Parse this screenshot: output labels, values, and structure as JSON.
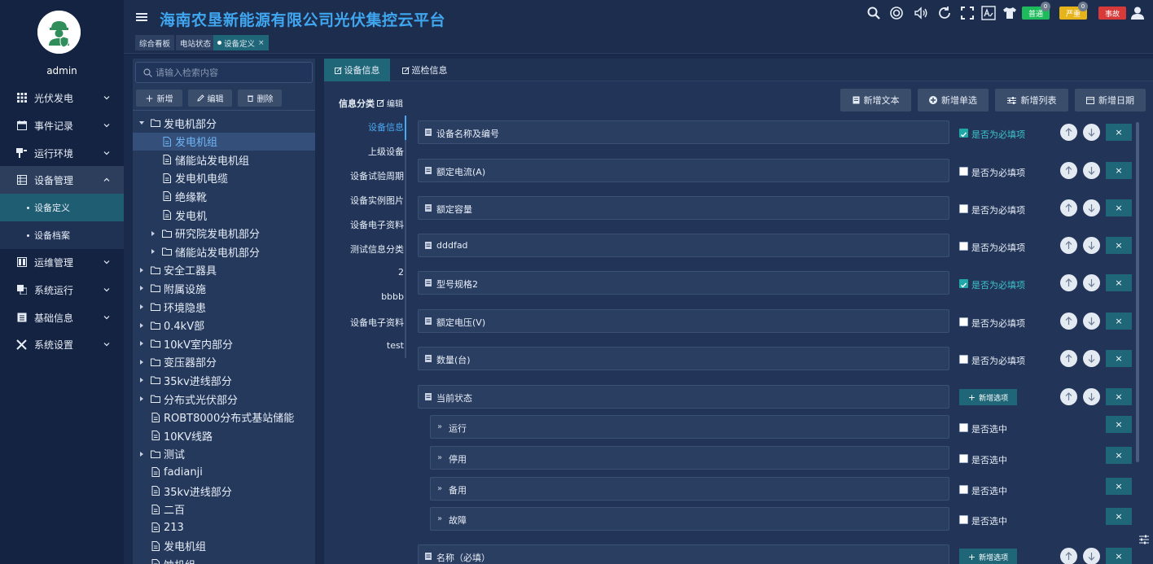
{
  "app": {
    "title": "海南农垦新能源有限公司光伏集控云平台"
  },
  "user": {
    "name": "admin"
  },
  "sidebar": {
    "items": [
      {
        "label": "光伏发电",
        "icon": "grid-icon"
      },
      {
        "label": "事件记录",
        "icon": "calendar-icon"
      },
      {
        "label": "运行环境",
        "icon": "environment-icon"
      },
      {
        "label": "设备管理",
        "icon": "device-icon"
      },
      {
        "label": "运维管理",
        "icon": "maintenance-icon"
      },
      {
        "label": "系统运行",
        "icon": "system-run-icon"
      },
      {
        "label": "基础信息",
        "icon": "info-icon"
      },
      {
        "label": "系统设置",
        "icon": "tools-icon"
      }
    ],
    "sub_items": [
      {
        "label": "设备定义"
      },
      {
        "label": "设备档案"
      }
    ]
  },
  "header": {
    "tabs": [
      {
        "label": "综合看板"
      },
      {
        "label": "电站状态"
      },
      {
        "label": "设备定义",
        "close": "×"
      }
    ],
    "badges": [
      {
        "label": "普通",
        "color": "#1dbb5c",
        "count": "0"
      },
      {
        "label": "严重",
        "color": "#e6b31a",
        "count": "0"
      },
      {
        "label": "事故",
        "color": "#d83a3a"
      }
    ]
  },
  "tree": {
    "search_placeholder": "请输入检索内容",
    "buttons": {
      "add": "新增",
      "edit": "编辑",
      "delete": "删除"
    },
    "nodes": [
      {
        "label": "发电机部分"
      },
      {
        "label": "发电机组"
      },
      {
        "label": "储能站发电机组"
      },
      {
        "label": "发电机电缆"
      },
      {
        "label": "绝缘靴"
      },
      {
        "label": "发电机"
      },
      {
        "label": "研究院发电机部分"
      },
      {
        "label": "储能站发电机部分"
      },
      {
        "label": "安全工器具"
      },
      {
        "label": "附属设施"
      },
      {
        "label": "环境隐患"
      },
      {
        "label": "0.4kV部"
      },
      {
        "label": "10kV室内部分"
      },
      {
        "label": "变压器部分"
      },
      {
        "label": "35kv进线部分"
      },
      {
        "label": "分布式光伏部分"
      },
      {
        "label": "ROBT8000分布式基站储能"
      },
      {
        "label": "10KV线路"
      },
      {
        "label": "测试"
      },
      {
        "label": "fadianji"
      },
      {
        "label": "35kv进线部分"
      },
      {
        "label": "二百"
      },
      {
        "label": "213"
      },
      {
        "label": "发电机组"
      },
      {
        "label": "蚀机组"
      }
    ]
  },
  "main": {
    "tabs": [
      {
        "label": "设备信息"
      },
      {
        "label": "巡检信息"
      }
    ],
    "category_label": "信息分类",
    "edit_label": "编辑",
    "action_buttons": {
      "add_text": "新增文本",
      "add_single": "新增单选",
      "add_list": "新增列表",
      "add_date": "新增日期"
    },
    "categories": [
      {
        "label": "设备信息"
      },
      {
        "label": "上级设备"
      },
      {
        "label": "设备试验周期"
      },
      {
        "label": "设备实例图片"
      },
      {
        "label": "设备电子资料"
      },
      {
        "label": "测试信息分类"
      },
      {
        "label": "2"
      },
      {
        "label": "bbbb"
      },
      {
        "label": "设备电子资料"
      },
      {
        "label": "test"
      }
    ],
    "required_label": "是否为必填项",
    "selected_label": "是否选中",
    "add_option_label": "新增选项",
    "delete_symbol": "×",
    "fields": [
      {
        "label": "设备名称及编号",
        "required": true
      },
      {
        "label": "额定电流(A)",
        "required": false
      },
      {
        "label": "额定容量",
        "required": false
      },
      {
        "label": "dddfad",
        "required": false
      },
      {
        "label": "型号规格2",
        "required": true
      },
      {
        "label": "额定电压(V)",
        "required": false
      },
      {
        "label": "数量(台)",
        "required": false
      },
      {
        "label": "当前状态",
        "type": "select"
      },
      {
        "label": "名称（必填）",
        "type": "select"
      }
    ],
    "options": [
      {
        "label": "运行",
        "selected": false
      },
      {
        "label": "停用",
        "selected": false
      },
      {
        "label": "备用",
        "selected": false
      },
      {
        "label": "故障",
        "selected": false
      }
    ]
  }
}
